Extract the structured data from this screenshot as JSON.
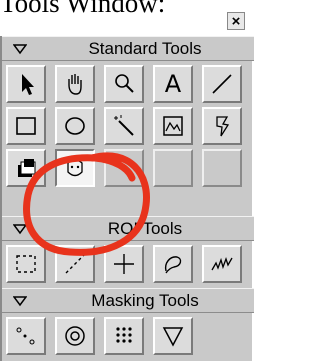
{
  "window": {
    "title": "Tools Window:",
    "close_glyph": "×"
  },
  "sections": {
    "standard": {
      "label": "Standard Tools"
    },
    "roi": {
      "label": "ROI Tools"
    },
    "masking": {
      "label": "Masking Tools"
    }
  },
  "standard_tools": [
    "arrow-pointer-icon",
    "hand-pan-icon",
    "magnifier-icon",
    "text-tool-icon",
    "line-tool-icon",
    "rectangle-tool-icon",
    "oval-tool-icon",
    "magic-wand-icon",
    "frame-image-icon",
    "wand-pen-icon",
    "stack-tool-icon",
    "face-tool-icon"
  ],
  "text_tool_glyph": "A",
  "selected_tool": "face-tool-icon",
  "annotation_color": "#e8331c"
}
